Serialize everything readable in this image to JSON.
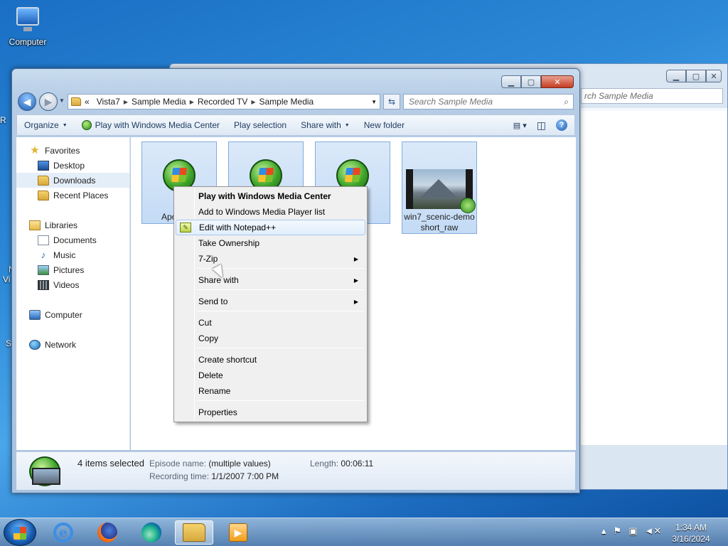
{
  "desktop": {
    "computer_label": "Computer",
    "edge_labels": [
      "R",
      "N",
      "Vi",
      "S"
    ]
  },
  "background_window": {
    "search_placeholder": "rch Sample Media"
  },
  "window": {
    "caption": {
      "minimize": "▁",
      "maximize": "▢",
      "close": "✕"
    },
    "breadcrumb": {
      "overflow": "«",
      "segments": [
        "Vista7",
        "Sample Media",
        "Recorded TV",
        "Sample Media"
      ]
    },
    "search_placeholder": "Search Sample Media",
    "toolbar": {
      "organize": "Organize",
      "play_wmc": "Play with Windows Media Center",
      "play_selection": "Play selection",
      "share_with": "Share with",
      "new_folder": "New folder"
    },
    "nav": {
      "favorites": "Favorites",
      "desktop": "Desktop",
      "downloads": "Downloads",
      "recent_places": "Recent Places",
      "libraries": "Libraries",
      "documents": "Documents",
      "music": "Music",
      "pictures": "Pictures",
      "videos": "Videos",
      "computer": "Computer",
      "network": "Network"
    },
    "files": [
      {
        "label": "Apo"
      },
      {
        "label": ""
      },
      {
        "label": ""
      },
      {
        "label": "win7_scenic-demoshort_raw"
      }
    ],
    "details": {
      "selected": "4 items selected",
      "episode_key": "Episode name:",
      "episode_val": "(multiple values)",
      "length_key": "Length:",
      "length_val": "00:06:11",
      "rec_key": "Recording time:",
      "rec_val": "1/1/2007 7:00 PM"
    }
  },
  "context_menu": {
    "items": [
      "Play with Windows Media Center",
      "Add to Windows Media Player list",
      "Edit with Notepad++",
      "Take Ownership",
      "7-Zip",
      "Share with",
      "Send to",
      "Cut",
      "Copy",
      "Create shortcut",
      "Delete",
      "Rename",
      "Properties"
    ]
  },
  "taskbar": {
    "time": "1:34 AM",
    "date": "3/16/2024",
    "ie_glyph": "e",
    "media_glyph": "▶"
  },
  "colors": {
    "accent": "#3b6ea5",
    "menu_highlight": "#e2eefc",
    "selection": "#c4dbf5"
  }
}
